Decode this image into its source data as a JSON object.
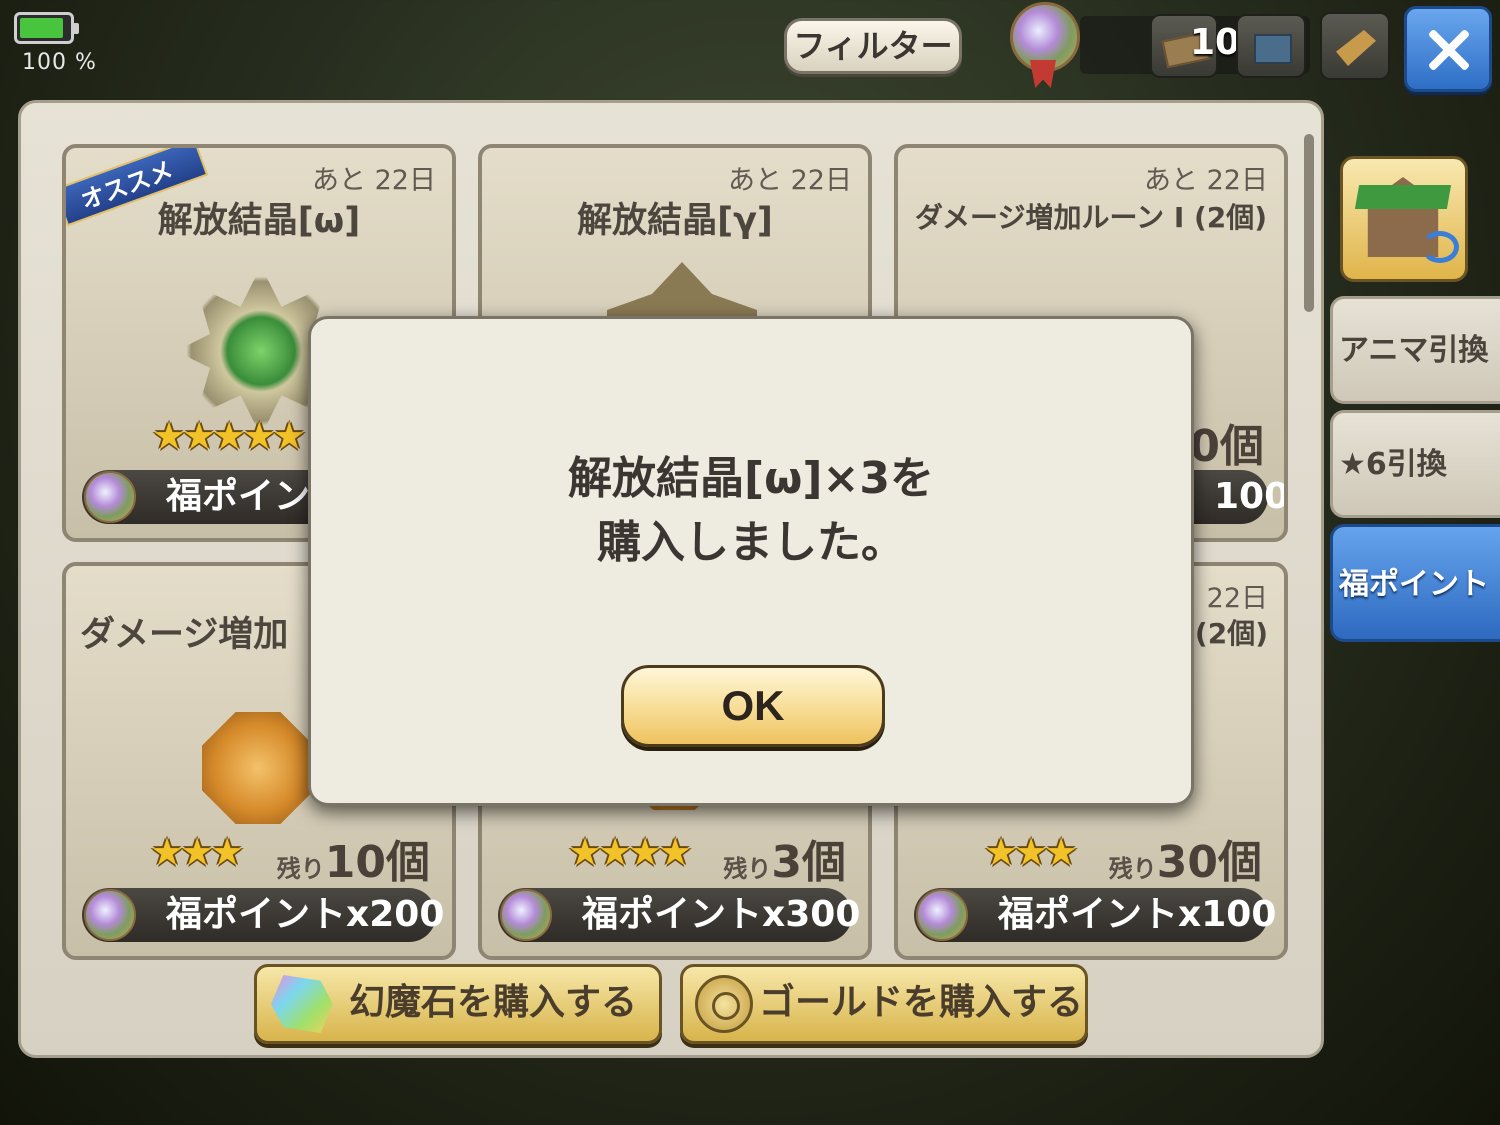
{
  "hud": {
    "battery_text": "100 %",
    "filter_label": "フィルター",
    "mail_count": "100"
  },
  "cards": [
    {
      "days": "あと 22日",
      "title": "解放結晶[ω]",
      "badge": "オススメ",
      "stars": "★★★★★",
      "price": "福ポイン"
    },
    {
      "days": "あと 22日",
      "title": "解放結晶[γ]"
    },
    {
      "days": "あと 22日",
      "title": "ダメージ増加ルーン I (2個)",
      "remain_partial": "0個",
      "price_partial": "100"
    },
    {
      "title_partial": "ダメージ増加",
      "stars": "★★★",
      "remain_prefix": "残り",
      "remain_num": "10個",
      "price": "福ポイントx200"
    },
    {
      "stars": "★★★★",
      "remain_prefix": "残り",
      "remain_num": "3個",
      "price": "福ポイントx300"
    },
    {
      "days_partial": "22日",
      "title_partial": "(2個)",
      "stars": "★★★",
      "remain_prefix": "残り",
      "remain_num": "30個",
      "price": "福ポイントx100"
    }
  ],
  "buttons": {
    "buy_stone": "幻魔石を購入する",
    "buy_gold": "ゴールドを購入する"
  },
  "side_tabs": [
    "アニマ引換",
    "★6引換",
    "福ポイント"
  ],
  "dialog": {
    "message": "解放結晶[ω]×3を\n購入しました。",
    "ok_label": "OK"
  },
  "colors": {
    "active_tab": "#2d6ac0",
    "ok_button": "#eec25e",
    "star": "#f2c229"
  }
}
